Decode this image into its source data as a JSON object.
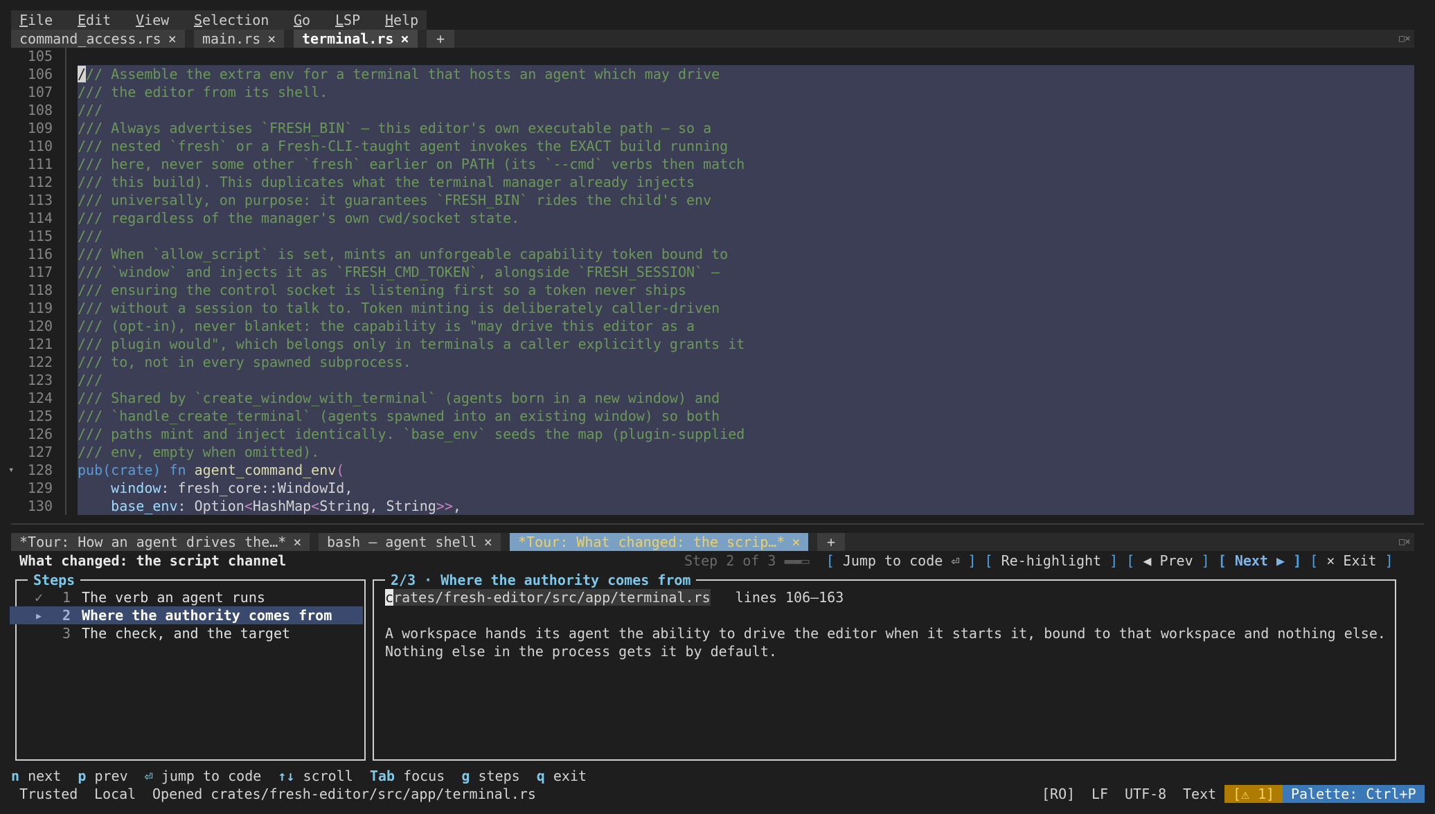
{
  "menu": [
    {
      "label": "File",
      "mnemonic": "F",
      "rest": "ile"
    },
    {
      "label": "Edit",
      "mnemonic": "E",
      "rest": "dit"
    },
    {
      "label": "View",
      "mnemonic": "V",
      "rest": "iew"
    },
    {
      "label": "Selection",
      "mnemonic": "S",
      "rest": "election"
    },
    {
      "label": "Go",
      "mnemonic": "G",
      "rest": "o"
    },
    {
      "label": "LSP",
      "mnemonic": "L",
      "rest": "SP"
    },
    {
      "label": "Help",
      "mnemonic": "H",
      "rest": "elp"
    }
  ],
  "editor_tabs": [
    {
      "label": "command_access.rs",
      "close": "×"
    },
    {
      "label": "main.rs",
      "close": "×"
    },
    {
      "label": "terminal.rs",
      "close": "×",
      "active": true
    },
    {
      "label": "+"
    }
  ],
  "split_controls": "□×",
  "editor": {
    "fold_marker": "▾",
    "lines": [
      {
        "n": "105",
        "text": ""
      },
      {
        "n": "106",
        "first": "/",
        "text": "// Assemble the extra env for a terminal that hosts an agent which may drive"
      },
      {
        "n": "107",
        "text": "/// the editor from its shell."
      },
      {
        "n": "108",
        "text": "///"
      },
      {
        "n": "109",
        "text": "/// Always advertises `FRESH_BIN` — this editor's own executable path — so a"
      },
      {
        "n": "110",
        "text": "/// nested `fresh` or a Fresh-CLI-taught agent invokes the EXACT build running"
      },
      {
        "n": "111",
        "text": "/// here, never some other `fresh` earlier on PATH (its `--cmd` verbs then match"
      },
      {
        "n": "112",
        "text": "/// this build). This duplicates what the terminal manager already injects"
      },
      {
        "n": "113",
        "text": "/// universally, on purpose: it guarantees `FRESH_BIN` rides the child's env"
      },
      {
        "n": "114",
        "text": "/// regardless of the manager's own cwd/socket state."
      },
      {
        "n": "115",
        "text": "///"
      },
      {
        "n": "116",
        "text": "/// When `allow_script` is set, mints an unforgeable capability token bound to"
      },
      {
        "n": "117",
        "text": "/// `window` and injects it as `FRESH_CMD_TOKEN`, alongside `FRESH_SESSION` —"
      },
      {
        "n": "118",
        "text": "/// ensuring the control socket is listening first so a token never ships"
      },
      {
        "n": "119",
        "text": "/// without a session to talk to. Token minting is deliberately caller-driven"
      },
      {
        "n": "120",
        "text": "/// (opt-in), never blanket: the capability is \"may drive this editor as a"
      },
      {
        "n": "121",
        "text": "/// plugin would\", which belongs only in terminals a caller explicitly grants it"
      },
      {
        "n": "122",
        "text": "/// to, not in every spawned subprocess."
      },
      {
        "n": "123",
        "text": "///"
      },
      {
        "n": "124",
        "text": "/// Shared by `create_window_with_terminal` (agents born in a new window) and"
      },
      {
        "n": "125",
        "text": "/// `handle_create_terminal` (agents spawned into an existing window) so both"
      },
      {
        "n": "126",
        "text": "/// paths mint and inject identically. `base_env` seeds the map (plugin-supplied"
      },
      {
        "n": "127",
        "text": "/// env, empty when omitted)."
      },
      {
        "n": "128",
        "code128": {
          "a": "pub(crate) ",
          "b": "fn ",
          "c": "agent_command_env",
          "d": "("
        }
      },
      {
        "n": "129",
        "code129": {
          "a": "    ",
          "b": "window",
          "c": ": fresh_core::WindowId,"
        }
      },
      {
        "n": "130",
        "code130": {
          "a": "    ",
          "b": "base_env",
          "c": ": Option",
          "d": "<",
          "e": "HashMap",
          "f": "<",
          "g": "String, String",
          "h": ">>",
          "i": ","
        }
      }
    ]
  },
  "panel_tabs": [
    {
      "label": "*Tour: How an agent drives the…*",
      "close": "×"
    },
    {
      "label": "bash — agent shell",
      "close": "×"
    },
    {
      "label": "*Tour: What changed: the scrip…*",
      "close": "×",
      "active": true
    },
    {
      "label": "+"
    }
  ],
  "tour": {
    "title": "What changed: the script channel",
    "step_indicator": "Step 2 of 3",
    "progress_glyph": "▬▬▭",
    "buttons": {
      "jump": "Jump to code ⏎",
      "rehighlight": "Re-highlight",
      "prev": "◀ Prev",
      "next": "Next ▶",
      "exit": "× Exit"
    },
    "steps_title": "Steps",
    "steps": [
      {
        "marker": "✓",
        "num": "1",
        "label": "The verb an agent runs"
      },
      {
        "marker": "▸",
        "num": "2",
        "label": "Where the authority comes from",
        "selected": true
      },
      {
        "marker": "",
        "num": "3",
        "label": "The check, and the target"
      }
    ],
    "detail_title": "2/3 · Where the authority comes from",
    "detail_path_first": "c",
    "detail_path_rest": "rates/fresh-editor/src/app/terminal.rs",
    "detail_lines": "lines 106–163",
    "detail_body_1": "A workspace hands its agent the ability to drive the editor when it starts it, bound to that workspace and nothing else.",
    "detail_body_2": "Nothing else in the process gets it by default."
  },
  "hints": [
    {
      "key": "n",
      "label": "next"
    },
    {
      "key": "p",
      "label": "prev"
    },
    {
      "key": "⏎",
      "label": "jump to code"
    },
    {
      "key": "↑↓",
      "label": "scroll"
    },
    {
      "key": "Tab",
      "label": "focus"
    },
    {
      "key": "g",
      "label": "steps"
    },
    {
      "key": "q",
      "label": "exit"
    }
  ],
  "status": {
    "trusted": "Trusted",
    "local": "Local",
    "message": "Opened crates/fresh-editor/src/app/terminal.rs",
    "ro": "[RO]",
    "eol": "LF",
    "encoding": "UTF-8",
    "language": "Text",
    "warnings": "[⚠ 1]",
    "palette": "Palette: Ctrl+P"
  }
}
